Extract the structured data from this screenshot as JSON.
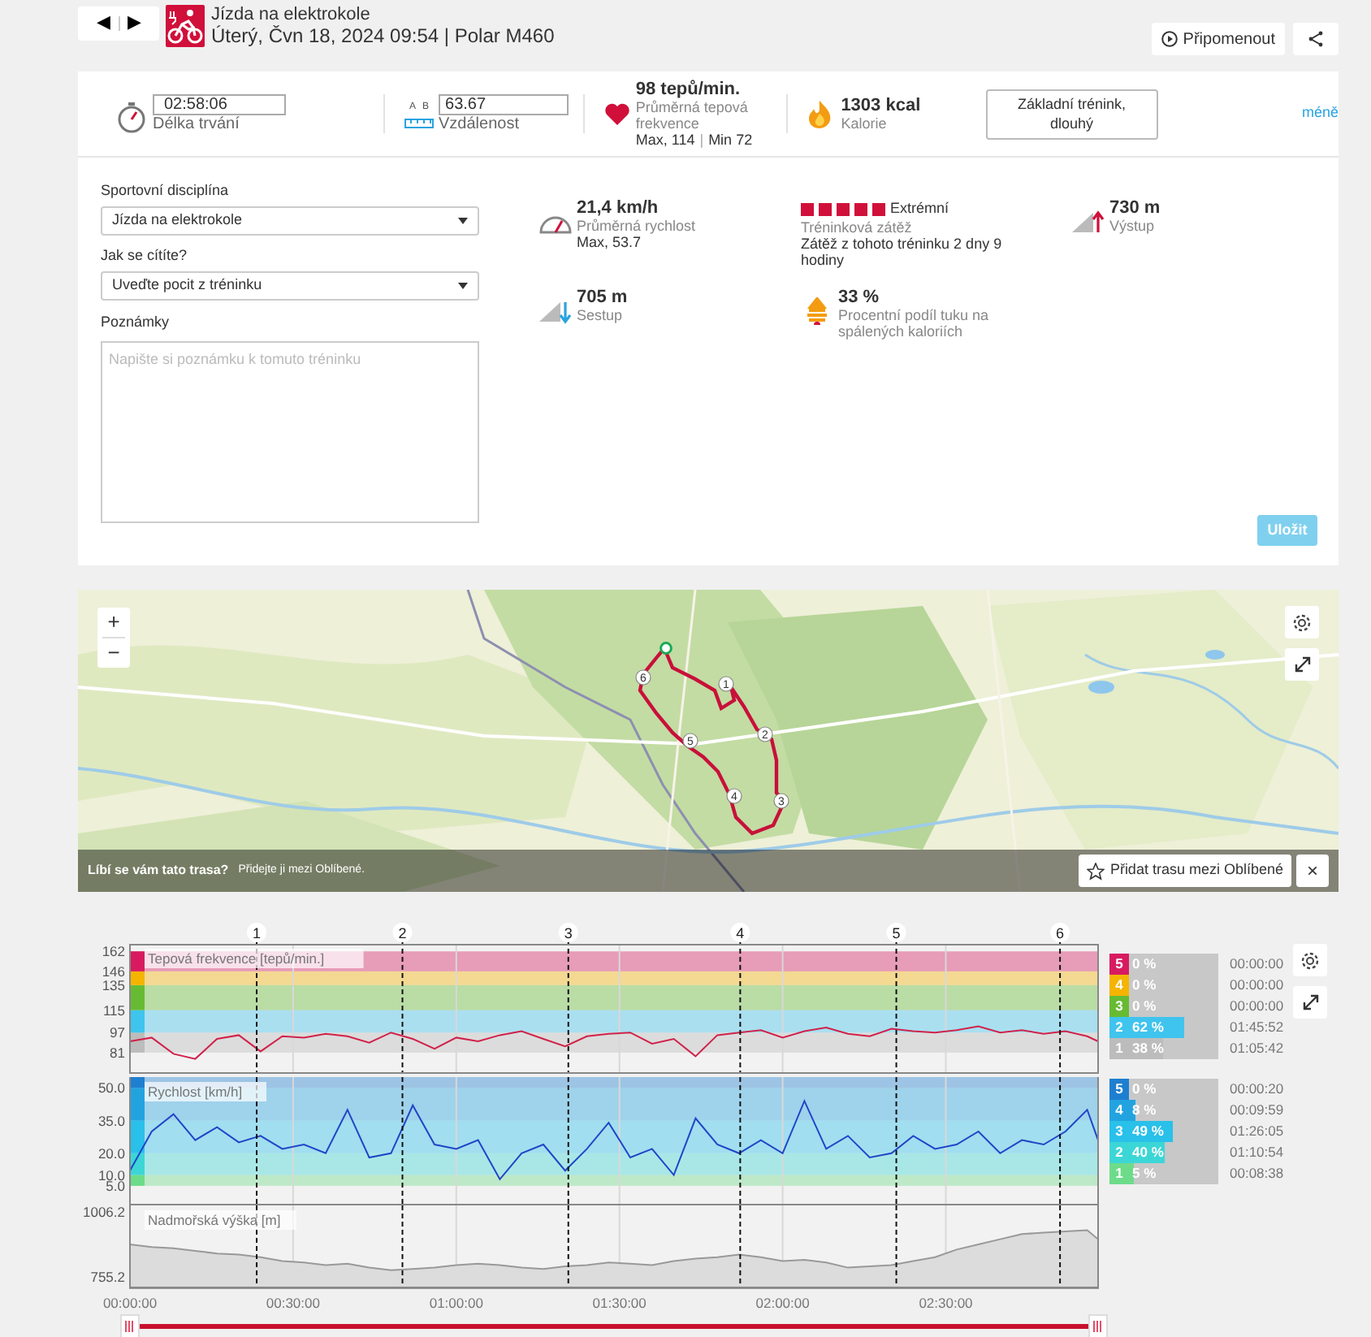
{
  "nav": {
    "prev": "◀",
    "next": "▶"
  },
  "header": {
    "sport": "Jízda na elektrokole",
    "subtitle": "Úterý, Čvn 18, 2024 09:54 | Polar M460"
  },
  "actions": {
    "replay": "Připomenout"
  },
  "summary": {
    "duration": {
      "value": "02:58:06",
      "label": "Délka trvání"
    },
    "distance": {
      "marks": [
        "A",
        "B"
      ],
      "value": "63.67",
      "label": "Vzdálenost"
    },
    "heart_rate": {
      "value": "98 tepů/min.",
      "label": "Průměrná tepová frekvence",
      "detail_max": "Max, 114",
      "separator": "|",
      "detail_min": "Min 72"
    },
    "calories": {
      "value": "1303 kcal",
      "label": "Kalorie"
    },
    "benefit": "Základní trénink, dlouhý",
    "toggle": "méně"
  },
  "details": {
    "sport_label": "Sportovní disciplína",
    "sport_value": "Jízda na elektrokole",
    "feeling_label": "Jak se cítíte?",
    "feeling_value": "Uveďte pocit z tréninku",
    "notes_label": "Poznámky",
    "notes_placeholder": "Napište si poznámku k tomuto tréninku",
    "save": {
      "label": "Uložit",
      "disabled": true
    }
  },
  "stats": [
    {
      "kind": "speed",
      "value": "21,4 km/h",
      "label": "Průměrná rychlost",
      "detail": "Max, 53.7"
    },
    {
      "kind": "load",
      "stars": 5,
      "rating": "Extrémní",
      "label": "Tréninková zátěž",
      "detail": "Zátěž z tohoto tréninku 2 dny 9 hodiny"
    },
    {
      "kind": "ascent",
      "value": "730 m",
      "label": "Výstup"
    },
    {
      "kind": "descent",
      "value": "705 m",
      "label": "Sestup"
    },
    {
      "kind": "fat",
      "value": "33 %",
      "label": "Procentní podíl tuku na spálených kaloriích"
    }
  ],
  "map": {
    "zoom_in": "+",
    "zoom_out": "−",
    "route_markers": [
      "1",
      "2",
      "3",
      "4",
      "5",
      "6"
    ],
    "banner": {
      "question": "Líbí se vám tato trasa?",
      "hint": "Přidejte ji mezi Oblíbené.",
      "button": "Přidat trasu mezi Oblíbené",
      "close": "×"
    }
  },
  "laps": [
    "1",
    "2",
    "3",
    "4",
    "5",
    "6"
  ],
  "charts": [
    {
      "chart_data": {
        "type": "line",
        "grid": true,
        "x": [
          0,
          4,
          8,
          12,
          16,
          20,
          24,
          28,
          32,
          36,
          40,
          44,
          48,
          52,
          56,
          60,
          64,
          68,
          72,
          76,
          80,
          84,
          88,
          92,
          96,
          100,
          104,
          108,
          112,
          116,
          120,
          124,
          128,
          132,
          136,
          140,
          144,
          148,
          152,
          156,
          160,
          164,
          168,
          172,
          176,
          178
        ],
        "xlim": [
          0,
          178
        ],
        "ylim": [
          64,
          168
        ],
        "yticks": [
          81,
          97,
          115,
          135,
          146,
          162
        ],
        "series": [
          {
            "name": "Tepová frekvence [tepů/min.]",
            "color": "#d0224a",
            "values": [
              90,
              93,
              80,
              76,
              92,
              95,
              82,
              94,
              93,
              96,
              94,
              89,
              97,
              92,
              84,
              93,
              90,
              95,
              98,
              92,
              86,
              94,
              96,
              97,
              88,
              92,
              78,
              95,
              97,
              99,
              93,
              98,
              101,
              96,
              94,
              100,
              98,
              97,
              99,
              102,
              97,
              99,
              96,
              98,
              94,
              90
            ]
          }
        ]
      },
      "zones": [
        {
          "number": "5",
          "percent": "0 %",
          "time": "00:00:00",
          "color": "#d81b60",
          "level": 0
        },
        {
          "number": "4",
          "percent": "0 %",
          "time": "00:00:00",
          "color": "#f4b400",
          "level": 0
        },
        {
          "number": "3",
          "percent": "0 %",
          "time": "00:00:00",
          "color": "#66bb33",
          "level": 0
        },
        {
          "number": "2",
          "percent": "62 %",
          "time": "01:45:52",
          "color": "#3fc4ee",
          "level": 0.62
        },
        {
          "number": "1",
          "percent": "38 %",
          "time": "01:05:42",
          "color": "#bcbcbc",
          "level": 0.38
        }
      ]
    },
    {
      "chart_data": {
        "type": "line",
        "grid": true,
        "x": [
          0,
          4,
          8,
          12,
          16,
          20,
          24,
          28,
          32,
          36,
          40,
          44,
          48,
          52,
          56,
          60,
          64,
          68,
          72,
          76,
          80,
          84,
          88,
          92,
          96,
          100,
          104,
          108,
          112,
          116,
          120,
          124,
          128,
          132,
          136,
          140,
          144,
          148,
          152,
          156,
          160,
          164,
          168,
          172,
          176,
          178
        ],
        "xlim": [
          0,
          178
        ],
        "ylim": [
          -4,
          55
        ],
        "yticks": [
          {
            "value": 5,
            "label": "5.0"
          },
          {
            "value": 10,
            "label": "10.0"
          },
          {
            "value": 20,
            "label": "20.0"
          },
          {
            "value": 35,
            "label": "35.0"
          },
          {
            "value": 50,
            "label": "50.0"
          }
        ],
        "series": [
          {
            "name": "Rychlost [km/h]",
            "color": "#2046c8",
            "values": [
              12,
              30,
              38,
              26,
              32,
              25,
              28,
              22,
              24,
              20,
              40,
              18,
              20,
              42,
              24,
              22,
              26,
              8,
              20,
              24,
              12,
              22,
              34,
              18,
              22,
              10,
              36,
              24,
              20,
              26,
              20,
              44,
              22,
              28,
              18,
              20,
              28,
              22,
              24,
              30,
              20,
              26,
              24,
              30,
              40,
              26
            ]
          }
        ]
      },
      "zones": [
        {
          "number": "5",
          "percent": "0 %",
          "time": "00:00:20",
          "color": "#1e7fd0",
          "level": 0
        },
        {
          "number": "4",
          "percent": "8 %",
          "time": "00:09:59",
          "color": "#22a3e0",
          "level": 0.08
        },
        {
          "number": "3",
          "percent": "49 %",
          "time": "01:26:05",
          "color": "#29c0ea",
          "level": 0.49
        },
        {
          "number": "2",
          "percent": "40 %",
          "time": "01:10:54",
          "color": "#3dd6d6",
          "level": 0.4
        },
        {
          "number": "1",
          "percent": "5 %",
          "time": "00:08:38",
          "color": "#6ddc8a",
          "level": 0.05
        }
      ]
    },
    {
      "chart_data": {
        "type": "area",
        "grid": true,
        "x": [
          0,
          4,
          8,
          12,
          16,
          20,
          24,
          28,
          32,
          36,
          40,
          44,
          48,
          52,
          56,
          60,
          64,
          68,
          72,
          76,
          80,
          84,
          88,
          92,
          96,
          100,
          104,
          108,
          112,
          116,
          120,
          124,
          128,
          132,
          136,
          140,
          144,
          148,
          152,
          156,
          160,
          164,
          168,
          172,
          176,
          178
        ],
        "xlim": [
          0,
          178
        ],
        "ylim": [
          710,
          1031
        ],
        "yticks": [
          {
            "value": 755.2,
            "label": "755.2"
          },
          {
            "value": 1006.2,
            "label": "1006.2"
          }
        ],
        "xticks": [
          {
            "value": 0,
            "label": "00:00:00"
          },
          {
            "value": 30,
            "label": "00:30:00"
          },
          {
            "value": 60,
            "label": "01:00:00"
          },
          {
            "value": 90,
            "label": "01:30:00"
          },
          {
            "value": 120,
            "label": "02:00:00"
          },
          {
            "value": 150,
            "label": "02:30:00"
          }
        ],
        "series": [
          {
            "name": "Nadmořská výška [m]",
            "color": "#999999",
            "values": [
              880,
              870,
              865,
              855,
              845,
              840,
              830,
              815,
              810,
              800,
              805,
              790,
              780,
              785,
              790,
              800,
              805,
              800,
              790,
              785,
              795,
              800,
              810,
              805,
              800,
              815,
              825,
              830,
              840,
              830,
              815,
              820,
              810,
              790,
              795,
              800,
              815,
              830,
              860,
              880,
              900,
              920,
              925,
              930,
              935,
              900
            ]
          }
        ]
      }
    }
  ],
  "timeline": {
    "handles": [
      {
        "level": 0
      },
      {
        "level": 1
      }
    ]
  }
}
